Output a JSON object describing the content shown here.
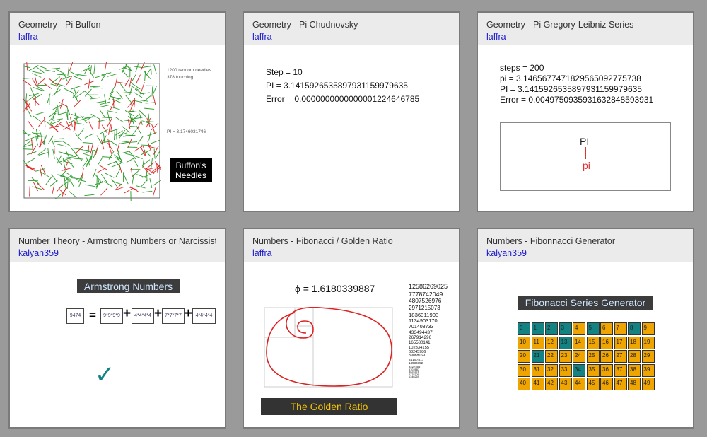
{
  "colors": {
    "teal": "#138282",
    "orange": "#f0a400",
    "gold": "#f5c400",
    "red": "#dd2222",
    "green": "#2a9a2a",
    "link": "#1a1acc"
  },
  "cards": [
    {
      "title": "Geometry - Pi Buffon",
      "author": "laffra",
      "buffon": {
        "needles": "1200 random needles",
        "touching": "378 touching",
        "pi": "PI = 3.1746031746",
        "label_line1": "Buffon's",
        "label_line2": "Needles"
      }
    },
    {
      "title": "Geometry - Pi Chudnovsky",
      "author": "laffra",
      "lines": [
        "Step = 10",
        "PI = 3.141592653589793115997963​5",
        "Error = 0.0000000000000001224646785"
      ]
    },
    {
      "title": "Geometry - Pi Gregory-Leibniz Series",
      "author": "laffra",
      "lines": [
        "steps = 200",
        "pi = 3.1465677471829565092775738",
        "PI = 3.1415926535897931159979635",
        "Error = 0.0049750935931632848593931"
      ],
      "pi_upper": "PI",
      "pi_lower": "pi"
    },
    {
      "title": "Number Theory - Armstrong Numbers or Narcissistic_n",
      "author": "kalyan359",
      "banner": "Armstrong Numbers",
      "boxes": [
        "9474",
        "9*9*9*9",
        "4*4*4*4",
        "7*7*7*7",
        "4*4*4*4"
      ],
      "equals": "=",
      "plus": "+",
      "check": "✓"
    },
    {
      "title": "Numbers - Fibonacci / Golden Ratio",
      "author": "laffra",
      "phi_text": "ϕ = 1.6180339887",
      "banner": "The Golden Ratio",
      "numbers": [
        "12586269025",
        "7778742049",
        "4807526976",
        "2971215073",
        "1836311903",
        "1134903170",
        "701408733",
        "433494437",
        "267914296",
        "165580141",
        "102334155",
        "63245986",
        "39088169",
        "24157817",
        "14930352",
        "9227465",
        "5702887",
        "3524578",
        "2178309",
        "1346269"
      ]
    },
    {
      "title": "Numbers - Fibonnacci Generator",
      "author": "kalyan359",
      "banner": "Fibonacci Series Generator",
      "cells": [
        "0",
        "1",
        "2",
        "3",
        "4",
        "5",
        "6",
        "7",
        "8",
        "9",
        "10",
        "11",
        "12",
        "13",
        "14",
        "15",
        "16",
        "17",
        "18",
        "19",
        "20",
        "21",
        "22",
        "23",
        "24",
        "25",
        "26",
        "27",
        "28",
        "29",
        "30",
        "31",
        "32",
        "33",
        "34",
        "35",
        "36",
        "37",
        "38",
        "39",
        "40",
        "41",
        "42",
        "43",
        "44",
        "45",
        "46",
        "47",
        "48",
        "49"
      ],
      "fib_numbers": [
        0,
        1,
        2,
        3,
        5,
        8,
        13,
        21,
        34
      ]
    }
  ]
}
